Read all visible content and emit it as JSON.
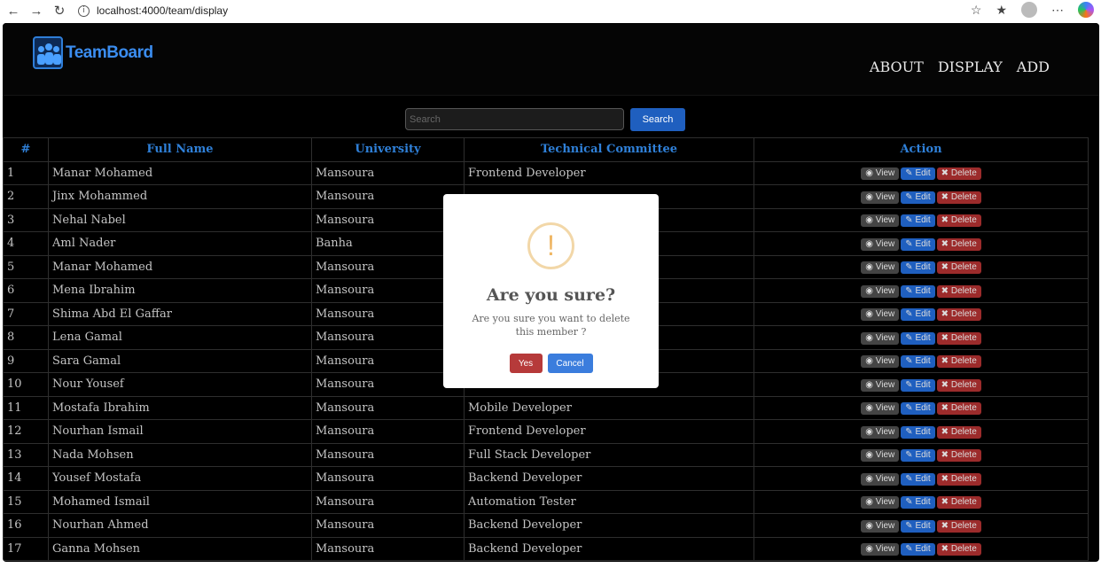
{
  "browser": {
    "url": "localhost:4000/team/display"
  },
  "header": {
    "logo_text": "TeamBoard",
    "nav": [
      "ABOUT",
      "DISPLAY",
      "ADD"
    ]
  },
  "search": {
    "placeholder": "Search",
    "button_label": "Search"
  },
  "table": {
    "headers": [
      "#",
      "Full Name",
      "University",
      "Technical Committee",
      "Action"
    ],
    "actions": [
      "View",
      "Edit",
      "Delete"
    ],
    "rows": [
      {
        "num": "1",
        "name": "Manar Mohamed",
        "university": "Mansoura",
        "committee": "Frontend Developer"
      },
      {
        "num": "2",
        "name": "Jinx Mohammed",
        "university": "Mansoura",
        "committee": ""
      },
      {
        "num": "3",
        "name": "Nehal Nabel",
        "university": "Mansoura",
        "committee": ""
      },
      {
        "num": "4",
        "name": "Aml Nader",
        "university": "Banha",
        "committee": ""
      },
      {
        "num": "5",
        "name": "Manar Mohamed",
        "university": "Mansoura",
        "committee": ""
      },
      {
        "num": "6",
        "name": "Mena Ibrahim",
        "university": "Mansoura",
        "committee": ""
      },
      {
        "num": "7",
        "name": "Shima Abd El Gaffar",
        "university": "Mansoura",
        "committee": ""
      },
      {
        "num": "8",
        "name": "Lena Gamal",
        "university": "Mansoura",
        "committee": ""
      },
      {
        "num": "9",
        "name": "Sara Gamal",
        "university": "Mansoura",
        "committee": ""
      },
      {
        "num": "10",
        "name": "Nour Yousef",
        "university": "Mansoura",
        "committee": ""
      },
      {
        "num": "11",
        "name": "Mostafa Ibrahim",
        "university": "Mansoura",
        "committee": "Mobile Developer"
      },
      {
        "num": "12",
        "name": "Nourhan Ismail",
        "university": "Mansoura",
        "committee": "Frontend Developer"
      },
      {
        "num": "13",
        "name": "Nada Mohsen",
        "university": "Mansoura",
        "committee": "Full Stack Developer"
      },
      {
        "num": "14",
        "name": "Yousef Mostafa",
        "university": "Mansoura",
        "committee": "Backend Developer"
      },
      {
        "num": "15",
        "name": "Mohamed Ismail",
        "university": "Mansoura",
        "committee": "Automation Tester"
      },
      {
        "num": "16",
        "name": "Nourhan Ahmed",
        "university": "Mansoura",
        "committee": "Backend Developer"
      },
      {
        "num": "17",
        "name": "Ganna Mohsen",
        "university": "Mansoura",
        "committee": "Backend Developer"
      }
    ]
  },
  "modal": {
    "icon": "!",
    "title": "Are you sure?",
    "text": "Are you sure you want to delete this member ?",
    "yes_label": "Yes",
    "cancel_label": "Cancel"
  }
}
